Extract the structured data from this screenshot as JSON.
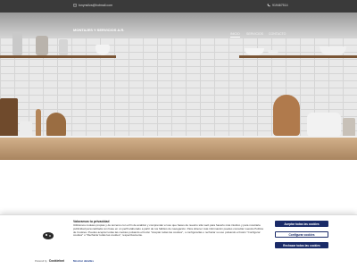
{
  "topbar": {
    "email": "tonynsilva@hotmail.com",
    "phone": "919467514"
  },
  "nav": {
    "brand": "MONTAJES Y SERVICIOS A.R.",
    "items": [
      {
        "label": "INICIO",
        "active": true
      },
      {
        "label": "SERVICIOS",
        "active": false
      },
      {
        "label": "CONTACTO",
        "active": false
      }
    ]
  },
  "cookie": {
    "title": "Valoramos tu privacidad",
    "text": "Utilizamos cookies propias y de terceros con el fin de analizar y comprender el uso que haces de nuestro sitio web para hacerlo más intuitivo y para mostrarte publicidad personalizada con base en un perfil elaborado a partir de tus hábitos de navegación. Para obtener más información puedes consultar nuestra Política de Cookies. Puedes aceptar todas las cookies pulsando el botón \"Aceptar todas las cookies\", o configurarlas o rechazar su uso pulsando el botón \"Configurar cookies\" o \"Rechazar todas las cookies\", respectivamente.",
    "more_label": "Mostrar detalles",
    "powered_by": "Powered by",
    "provider": "Cookiebot",
    "accept_label": "Aceptar todas las cookies",
    "configure_label": "Configurar cookies",
    "reject_label": "Rechazar todas las cookies"
  },
  "colors": {
    "topbar": "#3a3a3a",
    "button_primary": "#1a2b68"
  },
  "icons": {
    "email": "envelope-icon",
    "phone": "phone-icon",
    "cookie": "cookie-icon"
  }
}
